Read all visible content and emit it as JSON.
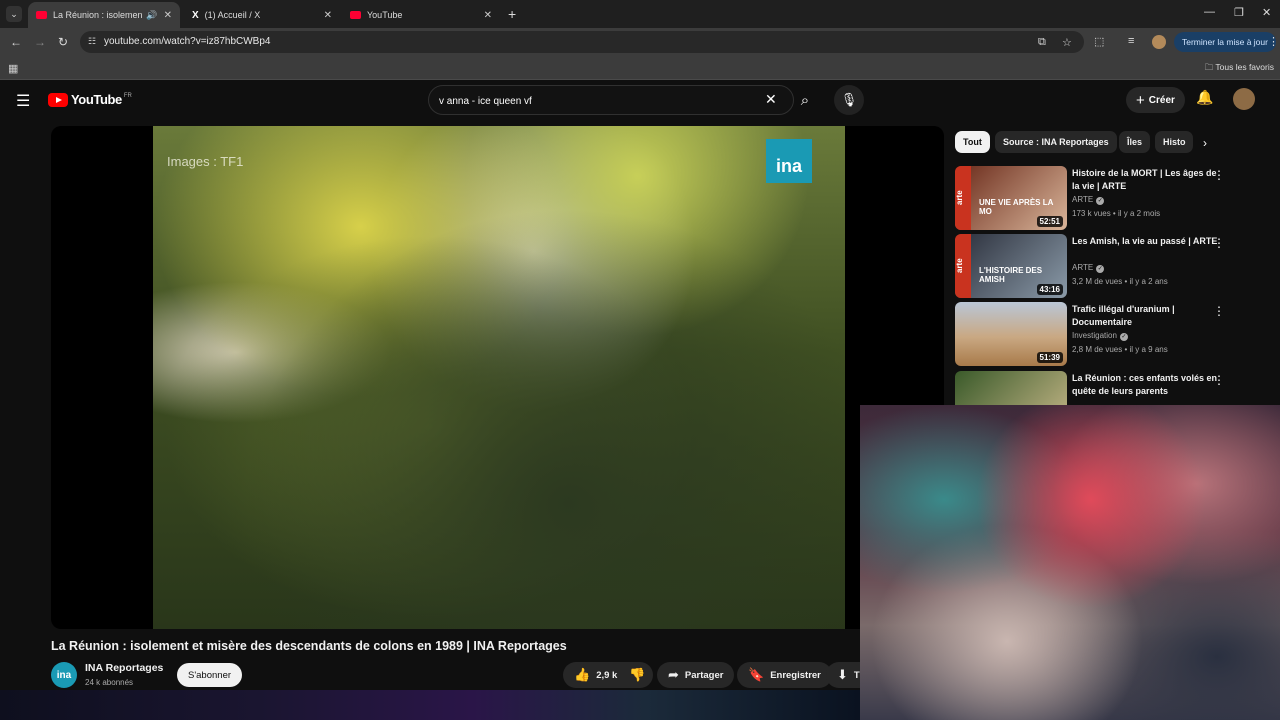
{
  "browser": {
    "tabs": [
      {
        "title": "La Réunion : isolement et m",
        "favicon": "youtube",
        "audio": true,
        "active": true
      },
      {
        "title": "(1) Accueil / X",
        "favicon": "x",
        "active": false
      },
      {
        "title": "YouTube",
        "favicon": "youtube",
        "active": false
      }
    ],
    "url": "youtube.com/watch?v=iz87hbCWBp4",
    "update_button": "Terminer la mise à jour",
    "bookmarks_all": "Tous les favoris"
  },
  "youtube": {
    "logo_text": "YouTube",
    "logo_country": "FR",
    "search_value": "v anna - ice queen vf",
    "create_label": "Créer"
  },
  "video": {
    "watermark_left": "Images : TF1",
    "watermark_right": "ina",
    "title": "La Réunion : isolement et misère des descendants de colons en 1989 | INA Reportages",
    "channel": "INA Reportages",
    "channel_avatar_text": "ina",
    "subscribers": "24 k abonnés",
    "subscribe_label": "S'abonner",
    "likes": "2,9 k",
    "share_label": "Partager",
    "save_label": "Enregistrer",
    "download_label": "Té"
  },
  "chips": [
    "Tout",
    "Source : INA Reportages",
    "Îles",
    "Histo"
  ],
  "recommendations": [
    {
      "title": "Histoire de la MORT | Les âges de la vie | ARTE",
      "channel": "ARTE",
      "meta": "173 k vues • il y a 2 mois",
      "duration": "52:51",
      "thumb_text": "UNE VIE APRÈS LA MO",
      "colors": [
        "#6a2a1a",
        "#d9b59a"
      ]
    },
    {
      "title": "Les Amish, la vie au passé | ARTE",
      "channel": "ARTE",
      "meta": "3,2 M de vues • il y a 2 ans",
      "duration": "43:16",
      "thumb_text": "L'HISTOIRE DES AMISH",
      "colors": [
        "#2a2e3a",
        "#8a9aa8"
      ]
    },
    {
      "title": "Trafic illégal d'uranium | Documentaire",
      "channel": "Investigation",
      "meta": "2,8 M de vues • il y a 9 ans",
      "duration": "51:39",
      "thumb_text": "",
      "colors": [
        "#b9c6d6",
        "#a87a4a"
      ]
    },
    {
      "title": "La Réunion : ces enfants volés en quête de leurs parents",
      "channel": "",
      "meta": "",
      "duration": "",
      "thumb_text": "",
      "colors": [
        "#3a5a2a",
        "#c9b98a"
      ]
    }
  ]
}
